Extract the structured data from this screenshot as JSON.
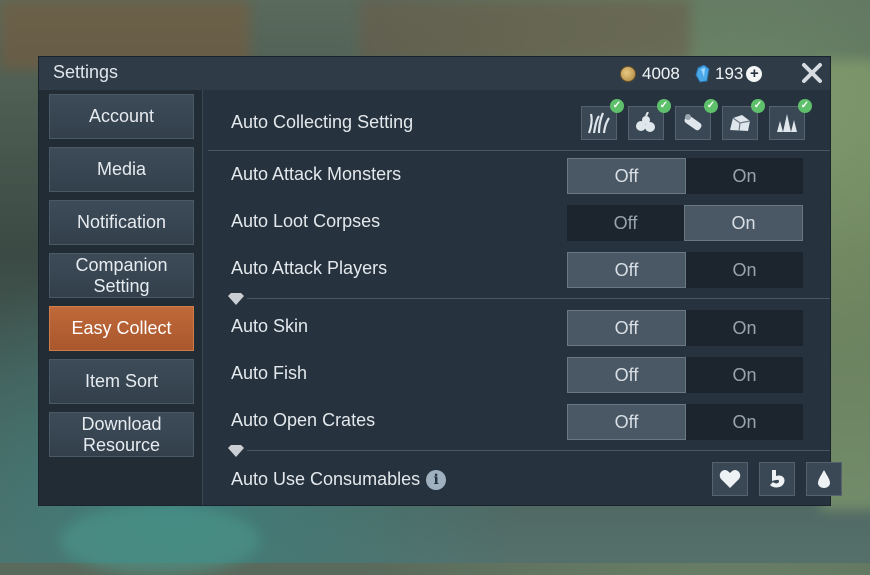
{
  "window": {
    "title": "Settings"
  },
  "currency": {
    "coins": "4008",
    "gems": "193"
  },
  "sidebar": {
    "items": [
      {
        "label": "Account",
        "active": false
      },
      {
        "label": "Media",
        "active": false
      },
      {
        "label": "Notification",
        "active": false
      },
      {
        "label": "Companion\nSetting",
        "active": false
      },
      {
        "label": "Easy Collect",
        "active": true
      },
      {
        "label": "Item Sort",
        "active": false
      },
      {
        "label": "Download\nResource",
        "active": false
      }
    ]
  },
  "settings": {
    "auto_collecting": {
      "label": "Auto Collecting Setting",
      "icons": [
        "grass-icon",
        "berries-icon",
        "log-icon",
        "stone-icon",
        "crystal-icon"
      ]
    },
    "rows": [
      {
        "label": "Auto Attack Monsters",
        "off": "Off",
        "on": "On",
        "value": "Off"
      },
      {
        "label": "Auto Loot Corpses",
        "off": "Off",
        "on": "On",
        "value": "On"
      },
      {
        "label": "Auto Attack Players",
        "off": "Off",
        "on": "On",
        "value": "Off"
      },
      {
        "label": "Auto Skin",
        "off": "Off",
        "on": "On",
        "value": "Off"
      },
      {
        "label": "Auto Fish",
        "off": "Off",
        "on": "On",
        "value": "Off"
      },
      {
        "label": "Auto Open Crates",
        "off": "Off",
        "on": "On",
        "value": "Off"
      }
    ],
    "consumables": {
      "label": "Auto Use Consumables",
      "info": "i",
      "icons": [
        "heart-icon",
        "stomach-icon",
        "water-drop-icon"
      ]
    }
  },
  "colors": {
    "accent": "#c0693a",
    "panel": "#26323d",
    "check": "#5ec06a"
  }
}
